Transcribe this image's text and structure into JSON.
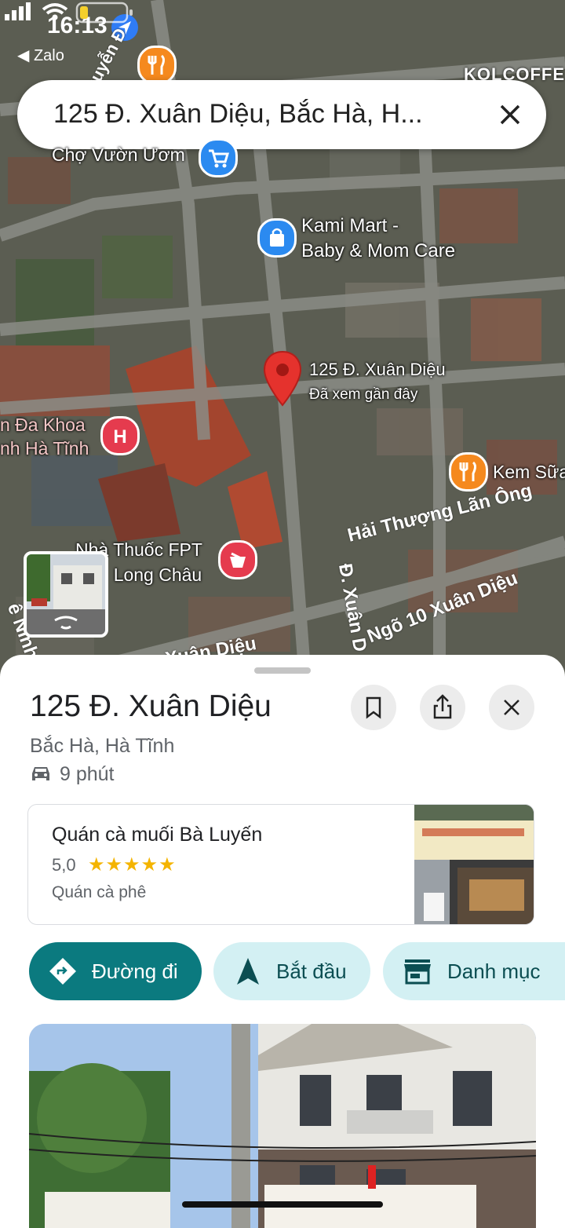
{
  "status_bar": {
    "time": "16:13",
    "back_app": "◀ Zalo"
  },
  "search": {
    "query": "125 Đ. Xuân Diệu, Bắc Hà, H..."
  },
  "map": {
    "top_right_label": "KOLCOFFE",
    "road_top_left": "Nguyễn Đ",
    "pins": {
      "cho": "Chợ Vườn Ươm",
      "kami_line1": "Kami Mart -",
      "kami_line2": "Baby & Mom Care",
      "selected_line1": "125 Đ. Xuân Diệu",
      "selected_line2": "Đã xem gần đây",
      "hospital_line1": "n Đa Khoa",
      "hospital_line2": "nh Hà Tĩnh",
      "kem": "Kem Sữa",
      "pharmacy_line1": "Nhà Thuốc FPT",
      "pharmacy_line2": "Long Châu"
    },
    "roads": {
      "hai_thuong": "Hải Thượng Lãn Ông",
      "xuan_dieu_v": "Đ. Xuân D",
      "ngo10": "Ngõ 10 Xuân Diệu",
      "xuan_dieu_bottom": "Xuân Diệu",
      "ninh": "ê Ninh"
    }
  },
  "place": {
    "title": "125 Đ. Xuân Diệu",
    "subtitle": "Bắc Hà, Hà Tĩnh",
    "drive_time": "9 phút"
  },
  "nearby": {
    "name": "Quán cà muối Bà Luyến",
    "rating": "5,0",
    "stars": "★★★★★",
    "category": "Quán cà phê"
  },
  "actions": {
    "directions": "Đường đi",
    "start": "Bắt đầu",
    "catalog": "Danh mục"
  },
  "colors": {
    "primary": "#0b7a7f",
    "chip_bg": "#d3f0f3",
    "pin_red": "#e5322d"
  }
}
